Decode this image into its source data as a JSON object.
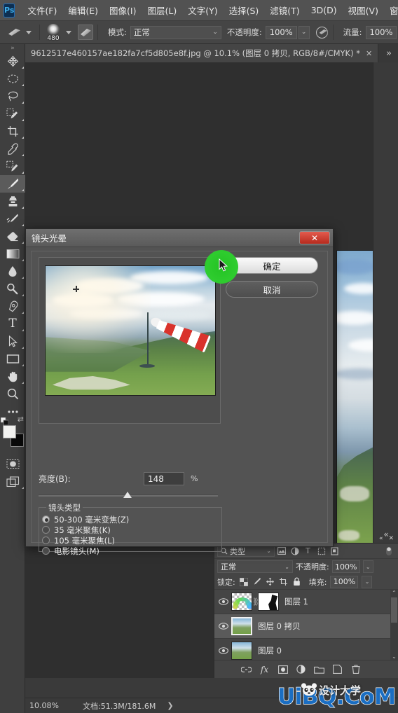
{
  "app": {
    "name": "Photoshop",
    "logo_text": "Ps"
  },
  "menubar": {
    "items": [
      {
        "label": "文件(F)",
        "name": "menu-file"
      },
      {
        "label": "编辑(E)",
        "name": "menu-edit"
      },
      {
        "label": "图像(I)",
        "name": "menu-image"
      },
      {
        "label": "图层(L)",
        "name": "menu-layer"
      },
      {
        "label": "文字(Y)",
        "name": "menu-type"
      },
      {
        "label": "选择(S)",
        "name": "menu-select"
      },
      {
        "label": "滤镜(T)",
        "name": "menu-filter"
      },
      {
        "label": "3D(D)",
        "name": "menu-3d"
      },
      {
        "label": "视图(V)",
        "name": "menu-view"
      },
      {
        "label": "窗口(W)",
        "name": "menu-window"
      }
    ]
  },
  "options_bar": {
    "brush_size": "480",
    "mode_label": "模式:",
    "mode_value": "正常",
    "opacity_label": "不透明度:",
    "opacity_value": "100%",
    "flow_label": "流量:",
    "flow_value": "100%"
  },
  "document_tab": {
    "title": "9612517e460157ae182fa7cf5d805e8f.jpg @ 10.1% (图层 0 拷贝, RGB/8#/CMYK) *",
    "close": "✕",
    "overflow": "»"
  },
  "toolbar": {
    "items": [
      {
        "name": "move-tool-icon",
        "label": "移动工具"
      },
      {
        "name": "marquee-tool-icon",
        "label": "选框工具"
      },
      {
        "name": "lasso-tool-icon",
        "label": "套索工具"
      },
      {
        "name": "quick-selection-tool-icon",
        "label": "快速选择工具"
      },
      {
        "name": "crop-tool-icon",
        "label": "裁剪工具"
      },
      {
        "name": "eyedropper-tool-icon",
        "label": "吸管工具"
      },
      {
        "name": "healing-brush-tool-icon",
        "label": "修复画笔工具"
      },
      {
        "name": "brush-tool-icon",
        "label": "画笔工具"
      },
      {
        "name": "clone-stamp-tool-icon",
        "label": "仿制图章工具"
      },
      {
        "name": "history-brush-tool-icon",
        "label": "历史记录画笔工具"
      },
      {
        "name": "eraser-tool-icon",
        "label": "橡皮擦工具"
      },
      {
        "name": "gradient-tool-icon",
        "label": "渐变工具"
      },
      {
        "name": "blur-tool-icon",
        "label": "模糊工具"
      },
      {
        "name": "dodge-tool-icon",
        "label": "减淡工具"
      },
      {
        "name": "pen-tool-icon",
        "label": "钢笔工具"
      },
      {
        "name": "type-tool-icon",
        "label": "文字工具"
      },
      {
        "name": "path-selection-tool-icon",
        "label": "路径选择工具"
      },
      {
        "name": "rectangle-tool-icon",
        "label": "矩形工具"
      },
      {
        "name": "hand-tool-icon",
        "label": "抓手工具"
      },
      {
        "name": "zoom-tool-icon",
        "label": "缩放工具"
      },
      {
        "name": "more-tools-icon",
        "label": "更多工具"
      }
    ],
    "active_index": 7,
    "type_glyph": "T",
    "foreground_color": "#f2f2f0",
    "background_color": "#0a0a0a"
  },
  "dialog": {
    "title": "镜头光晕",
    "close_label": "✕",
    "ok_label": "确定",
    "cancel_label": "取消",
    "brightness_label": "亮度(B):",
    "brightness_value": "148",
    "brightness_unit": "%",
    "lens_type_legend": "镜头类型",
    "lens_options": [
      {
        "label": "50-300 毫米变焦(Z)",
        "checked": true
      },
      {
        "label": "35 毫米聚焦(K)",
        "checked": false
      },
      {
        "label": "105 毫米聚焦(L)",
        "checked": false
      },
      {
        "label": "电影镜头(M)",
        "checked": false
      }
    ]
  },
  "layers_panel": {
    "filter_label": "类型",
    "blend_mode": "正常",
    "opacity_label": "不透明度:",
    "opacity_value": "100%",
    "lock_label": "锁定:",
    "fill_label": "填充:",
    "fill_value": "100%",
    "rows": [
      {
        "name": "图层 1",
        "selected": false,
        "has_mask": true,
        "thumb": "rainbow"
      },
      {
        "name": "图层 0 拷贝",
        "selected": true,
        "has_mask": false,
        "thumb": "photo"
      },
      {
        "name": "图层 0",
        "selected": false,
        "has_mask": false,
        "thumb": "photo"
      }
    ],
    "bottom_icons": [
      {
        "name": "link-layers-icon",
        "glyph": "⛓"
      },
      {
        "name": "layer-style-fx-icon",
        "glyph": "fx"
      },
      {
        "name": "add-mask-icon",
        "glyph": "◉"
      },
      {
        "name": "adjustment-layer-icon",
        "glyph": "◑"
      },
      {
        "name": "new-group-icon",
        "glyph": "🗀"
      },
      {
        "name": "new-layer-icon",
        "glyph": "❐"
      },
      {
        "name": "delete-layer-icon",
        "glyph": "🗑"
      }
    ]
  },
  "status_bar": {
    "zoom": "10.08%",
    "doc_info": "文档:51.3M/181.6M",
    "arrow": "❯"
  },
  "watermark": {
    "text": "UiBQ.CoM",
    "subtext": "设计大学"
  },
  "colors": {
    "accent_green": "#2ecc2e",
    "close_red": "#c9342a",
    "panel_bg": "#454545",
    "canvas_bg": "#2f2f2f",
    "watermark_blue": "#1b6ec2"
  }
}
